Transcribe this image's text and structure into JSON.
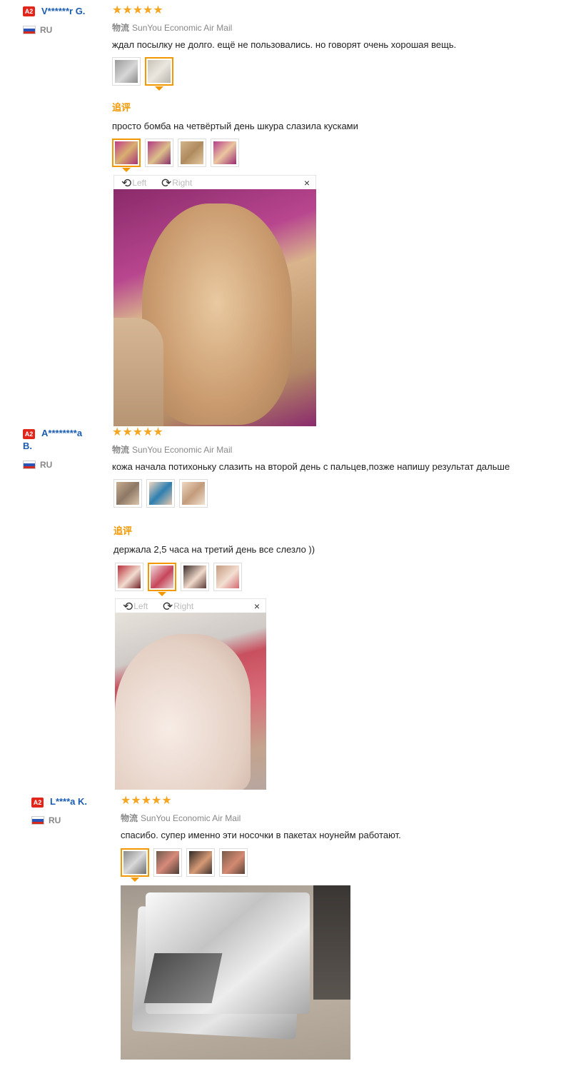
{
  "shipping_prefix": "物流",
  "viewer": {
    "left": "Left",
    "right": "Right",
    "close": "×"
  },
  "followup_label": "追评",
  "reviews": [
    {
      "badge": "A2",
      "user": "V******r G.",
      "country": "RU",
      "stars": "★★★★★",
      "shipping": "SunYou Economic Air Mail",
      "text": "ждал посылку не долго. ещё не пользовались. но говорят очень хорошая вещь.",
      "followup_text": "просто бомба на четвёртый день шкура слазила кусками"
    },
    {
      "badge": "A2",
      "user_line1": "A********a",
      "user_line2": "B.",
      "country": "RU",
      "stars": "★★★★★",
      "shipping": "SunYou Economic Air Mail",
      "text": "кожа начала потихоньку слазить на второй день с пальцев,позже напишу результат дальше",
      "followup_text": "держала 2,5 часа на третий день все слезло ))"
    },
    {
      "badge": "A2",
      "user": "L****a K.",
      "country": "RU",
      "stars": "★★★★★",
      "shipping": "SunYou Economic Air Mail",
      "text": "спасибо. супер именно эти носочки в пакетах ноунейм работают."
    }
  ]
}
